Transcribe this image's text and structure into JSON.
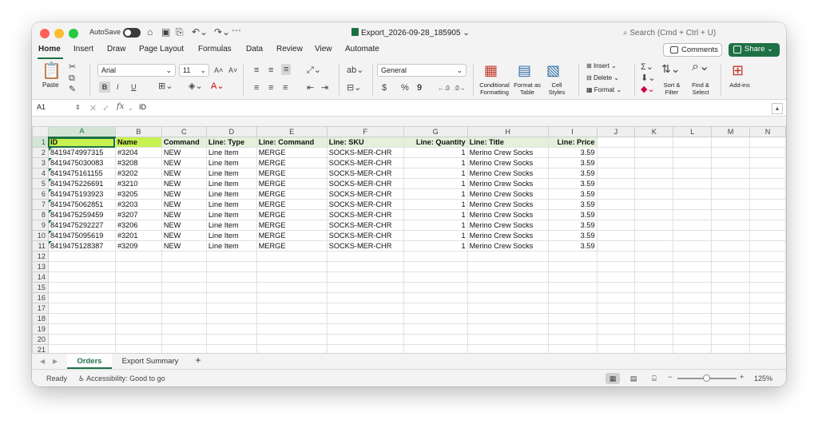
{
  "titlebar": {
    "autosave_label": "AutoSave",
    "doc_title": "Export_2026-09-28_185905",
    "search_placeholder": "Search (Cmd + Ctrl + U)"
  },
  "ribbon_tabs": [
    "Home",
    "Insert",
    "Draw",
    "Page Layout",
    "Formulas",
    "Data",
    "Review",
    "View",
    "Automate"
  ],
  "ribbon": {
    "comments_label": "Comments",
    "share_label": "Share",
    "paste_label": "Paste",
    "font_name": "Arial",
    "font_size": "11",
    "number_format": "General",
    "conditional_formatting": "Conditional Formatting",
    "format_as_table": "Format as Table",
    "cell_styles": "Cell Styles",
    "insert_label": "Insert",
    "delete_label": "Delete",
    "format_label": "Format",
    "sort_filter": "Sort & Filter",
    "find_select": "Find & Select",
    "addins": "Add-ins",
    "bold": "B",
    "italic": "I",
    "underline": "U",
    "currency": "$",
    "percent": "%",
    "comma": "9"
  },
  "formula_bar": {
    "name_box": "A1",
    "fx": "fx",
    "content": "ID"
  },
  "grid": {
    "columns": [
      "A",
      "B",
      "C",
      "D",
      "E",
      "F",
      "G",
      "H",
      "I",
      "J",
      "K",
      "L",
      "M",
      "N"
    ],
    "header_row": [
      "ID",
      "Name",
      "Command",
      "Line: Type",
      "Line: Command",
      "Line: SKU",
      "Line: Quantity",
      "Line: Title",
      "Line: Price"
    ],
    "rows": [
      [
        "8419474997315",
        "#3204",
        "NEW",
        "Line Item",
        "MERGE",
        "SOCKS-MER-CHR",
        "1",
        "Merino Crew Socks",
        "3.59"
      ],
      [
        "8419475030083",
        "#3208",
        "NEW",
        "Line Item",
        "MERGE",
        "SOCKS-MER-CHR",
        "1",
        "Merino Crew Socks",
        "3.59"
      ],
      [
        "8419475161155",
        "#3202",
        "NEW",
        "Line Item",
        "MERGE",
        "SOCKS-MER-CHR",
        "1",
        "Merino Crew Socks",
        "3.59"
      ],
      [
        "8419475226691",
        "#3210",
        "NEW",
        "Line Item",
        "MERGE",
        "SOCKS-MER-CHR",
        "1",
        "Merino Crew Socks",
        "3.59"
      ],
      [
        "8419475193923",
        "#3205",
        "NEW",
        "Line Item",
        "MERGE",
        "SOCKS-MER-CHR",
        "1",
        "Merino Crew Socks",
        "3.59"
      ],
      [
        "8419475062851",
        "#3203",
        "NEW",
        "Line Item",
        "MERGE",
        "SOCKS-MER-CHR",
        "1",
        "Merino Crew Socks",
        "3.59"
      ],
      [
        "8419475259459",
        "#3207",
        "NEW",
        "Line Item",
        "MERGE",
        "SOCKS-MER-CHR",
        "1",
        "Merino Crew Socks",
        "3.59"
      ],
      [
        "8419475292227",
        "#3206",
        "NEW",
        "Line Item",
        "MERGE",
        "SOCKS-MER-CHR",
        "1",
        "Merino Crew Socks",
        "3.59"
      ],
      [
        "8419475095619",
        "#3201",
        "NEW",
        "Line Item",
        "MERGE",
        "SOCKS-MER-CHR",
        "1",
        "Merino Crew Socks",
        "3.59"
      ],
      [
        "8419475128387",
        "#3209",
        "NEW",
        "Line Item",
        "MERGE",
        "SOCKS-MER-CHR",
        "1",
        "Merino Crew Socks",
        "3.59"
      ]
    ],
    "row_numbers": [
      "1",
      "2",
      "3",
      "4",
      "5",
      "6",
      "7",
      "8",
      "9",
      "10",
      "11",
      "12",
      "13",
      "14",
      "15",
      "16",
      "17",
      "18",
      "19",
      "20",
      "21"
    ]
  },
  "sheets": {
    "tabs": [
      "Orders",
      "Export Summary"
    ],
    "active": "Orders",
    "add_label": "+"
  },
  "status": {
    "ready": "Ready",
    "accessibility": "Accessibility: Good to go",
    "zoom": "125%"
  },
  "colors": {
    "accent": "#1e7145",
    "highlight": "#c8f250",
    "header_fill": "#e4f0dc"
  }
}
